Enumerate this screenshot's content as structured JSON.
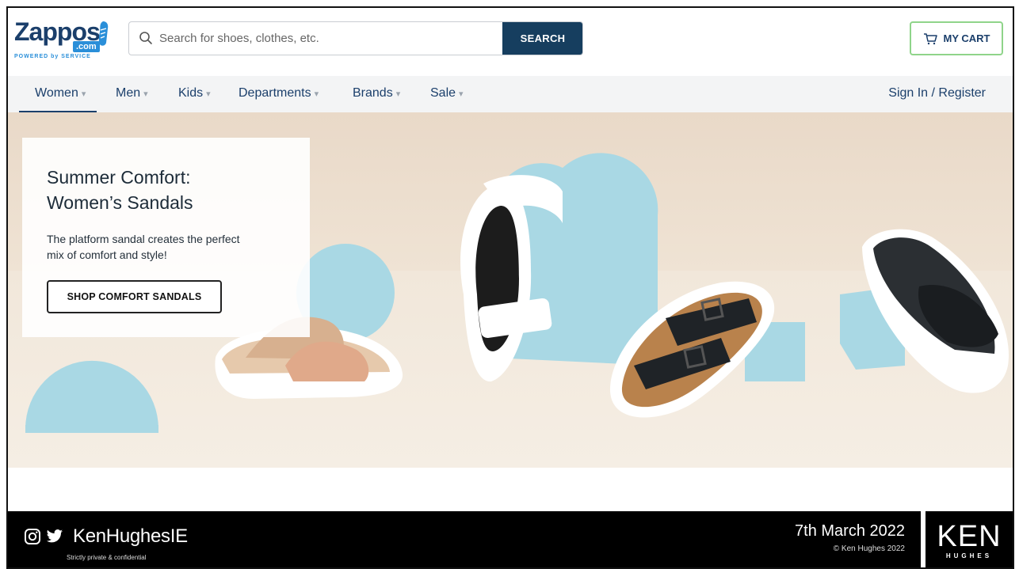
{
  "header": {
    "logo": {
      "wordmark": "Zappos",
      "domain_badge": ".com",
      "tagline": "POWERED by SERVICE"
    },
    "search": {
      "placeholder": "Search for shoes, clothes, etc.",
      "value": "",
      "button_label": "SEARCH"
    },
    "cart": {
      "label": "MY CART"
    }
  },
  "nav": {
    "items": [
      {
        "label": "Women",
        "active": true
      },
      {
        "label": "Men",
        "active": false
      },
      {
        "label": "Kids",
        "active": false
      },
      {
        "label": "Departments",
        "active": false
      },
      {
        "label": "Brands",
        "active": false
      },
      {
        "label": "Sale",
        "active": false
      }
    ],
    "account_link": "Sign In / Register"
  },
  "hero": {
    "title_line1": "Summer Comfort:",
    "title_line2": "Women’s Sandals",
    "body_line1": "The platform sandal creates the perfect",
    "body_line2": "mix of comfort and style!",
    "cta_label": "SHOP COMFORT SANDALS"
  },
  "footer": {
    "handle": "KenHughesIE",
    "confidential": "Strictly private & confidential",
    "date": "7th March 2022",
    "copyright": "© Ken Hughes 2022",
    "brand_big": "KEN",
    "brand_small": "HUGHES"
  },
  "colors": {
    "brand_navy": "#163e5f",
    "cart_border": "#8fd48a",
    "hero_blue": "#a9d8e4",
    "hero_beige": "#efe6da"
  },
  "icons": [
    "search-icon",
    "cart-icon",
    "caret-down-icon",
    "instagram-icon",
    "twitter-icon",
    "zappos-shoe-icon"
  ]
}
